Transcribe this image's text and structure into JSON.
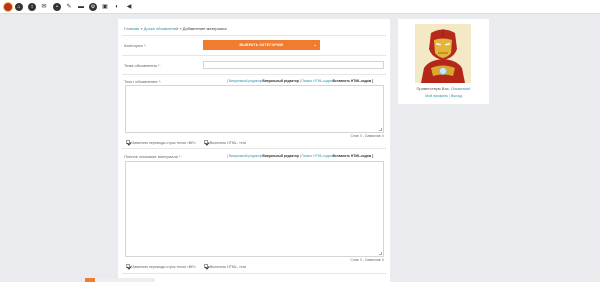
{
  "topbar": {
    "icons": [
      "user-icon",
      "home-icon",
      "info-icon",
      "mail-icon",
      "settings-icon",
      "wrench-icon",
      "gear-icon",
      "folder-icon",
      "bell-icon",
      "search-icon",
      "sound-icon"
    ]
  },
  "breadcrumb": {
    "home": "Главная",
    "sep1": "»",
    "board": "Доска объявлений",
    "sep2": "»",
    "current": "Добавление материала"
  },
  "form": {
    "category_label": "Категория",
    "category_button": "ВЫБРАТЬ КАТЕГОРИЮ",
    "subject_label": "Тема объявления",
    "subject_value": "",
    "text_label": "Текст объявления",
    "full_label": "Полное описание материала",
    "required_mark": "*:",
    "editor_visual": "[ Визуальный редактор",
    "editor_simple": "Визуальный редактор",
    "editor_pipe": "|",
    "editor_html": "Писать HTML-кодом",
    "editor_safe": "Вставлять HTML-кодом ]",
    "counter_text": "Слов: 0 , Символов: 0",
    "opt_linebreaks": "Заменять переводы строк тегом <BR>",
    "opt_html": "Включить HTML- теги"
  },
  "profile": {
    "welcome": "Приветствую Вас,",
    "username": "Ольвеноя",
    "excl": "!",
    "my_profile": "Мой профиль",
    "pipe": "|",
    "logout": "Выход"
  },
  "colors": {
    "accent": "#f07d2f",
    "link": "#2f8fa7",
    "background": "#e9ebee"
  }
}
